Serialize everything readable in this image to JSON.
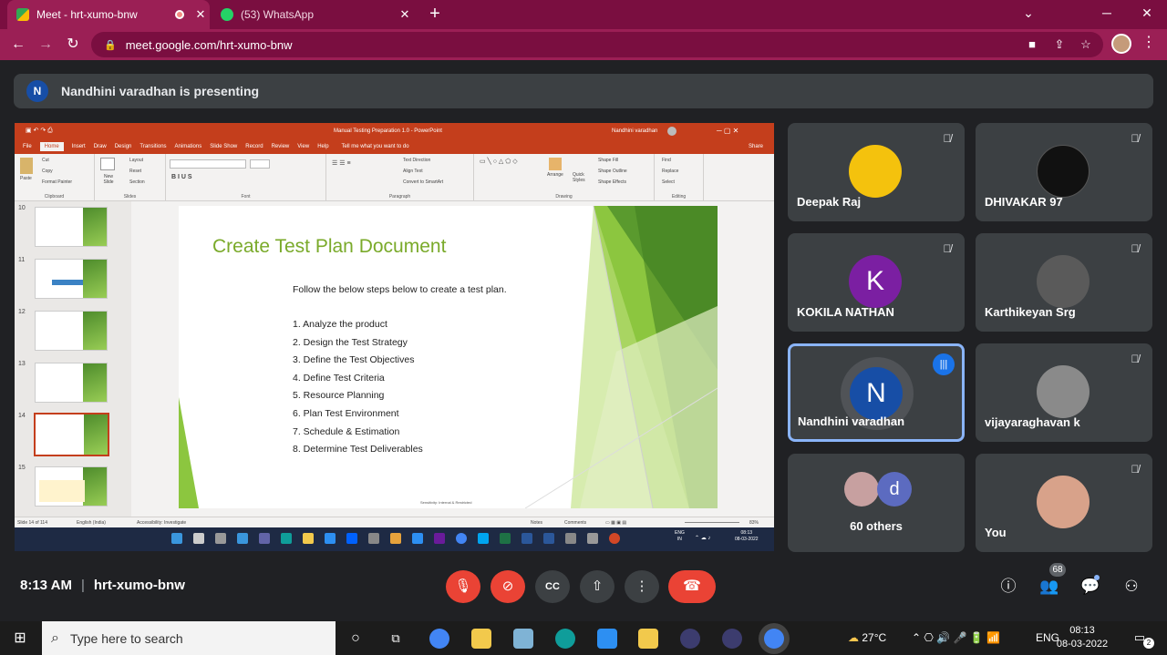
{
  "browser": {
    "tabs": [
      {
        "title": "Meet - hrt-xumo-bnw",
        "active": true
      },
      {
        "title": "(53) WhatsApp",
        "active": false
      }
    ],
    "url": "meet.google.com/hrt-xumo-bnw"
  },
  "presenting_banner": {
    "initial": "N",
    "text": "Nandhini varadhan is presenting"
  },
  "powerpoint": {
    "title": "Manual Testing Preparation 1.0 - PowerPoint",
    "user": "Nandhini varadhan",
    "share_label": "Share",
    "ribbon_tabs": [
      "File",
      "Home",
      "Insert",
      "Draw",
      "Design",
      "Transitions",
      "Animations",
      "Slide Show",
      "Record",
      "Review",
      "View",
      "Help",
      "Tell me what you want to do"
    ],
    "ribbon_groups": [
      "Clipboard",
      "Slides",
      "Font",
      "Paragraph",
      "Drawing",
      "Editing"
    ],
    "clipboard_items": [
      "Cut",
      "Copy",
      "Format Painter"
    ],
    "paste_label": "Paste",
    "slide_items": [
      "Layout",
      "Reset",
      "Section"
    ],
    "new_slide_label": "New Slide",
    "editing_items": [
      "Find",
      "Replace",
      "Select"
    ],
    "drawing_items": [
      "Shape Fill",
      "Shape Outline",
      "Shape Effects"
    ],
    "arrange_label": "Arrange",
    "quick_styles_label": "Quick Styles",
    "paragraph_items": [
      "Text Direction",
      "Align Text",
      "Convert to SmartArt"
    ],
    "thumbnails": [
      "10",
      "11",
      "12",
      "13",
      "14",
      "15"
    ],
    "slide": {
      "title": "Create Test Plan Document",
      "intro": "Follow the below steps below to create a test plan.",
      "steps": [
        "1. Analyze the product",
        "2. Design the Test Strategy",
        "3. Define the Test Objectives",
        "4. Define Test Criteria",
        "5. Resource Planning",
        "6. Plan Test Environment",
        "7. Schedule & Estimation",
        "8. Determine Test Deliverables"
      ],
      "footer": "Sensitivity: Internal & Restricted"
    },
    "status": {
      "slide_count": "Slide 14 of 114",
      "language": "English (India)",
      "accessibility": "Accessibility: Investigate",
      "notes": "Notes",
      "comments": "Comments",
      "zoom": "83%"
    },
    "inner_taskbar": {
      "lang": "ENG",
      "lang_sub": "IN",
      "time": "08:13",
      "date": "08-03-2022"
    }
  },
  "participants": [
    {
      "name": "Deepak Raj",
      "muted": true,
      "avatar_color": "#f4c20d"
    },
    {
      "name": "DHIVAKAR 97",
      "muted": true,
      "avatar_color": "#111111"
    },
    {
      "name": "KOKILA NATHAN",
      "initial": "K",
      "muted": true,
      "avatar_color": "#7b1fa2"
    },
    {
      "name": "Karthikeyan Srg",
      "muted": true,
      "avatar_color": "#5a5a5a"
    },
    {
      "name": "Nandhini varadhan",
      "initial": "N",
      "speaking": true,
      "avatar_color": "#174ea6"
    },
    {
      "name": "vijayaraghavan k",
      "muted": true,
      "avatar_color": "#8a8a8a"
    },
    {
      "name": "60 others",
      "initial": "d",
      "avatar_color": "#5c6bc0"
    },
    {
      "name": "You",
      "muted": true,
      "avatar_color": "#d8a28a"
    }
  ],
  "meeting": {
    "time": "8:13 AM",
    "code": "hrt-xumo-bnw",
    "participant_count": "68"
  },
  "windows_taskbar": {
    "search_placeholder": "Type here to search",
    "weather": "27°C",
    "lang": "ENG",
    "time": "08:13",
    "date": "08-03-2022",
    "notifications": "2"
  }
}
